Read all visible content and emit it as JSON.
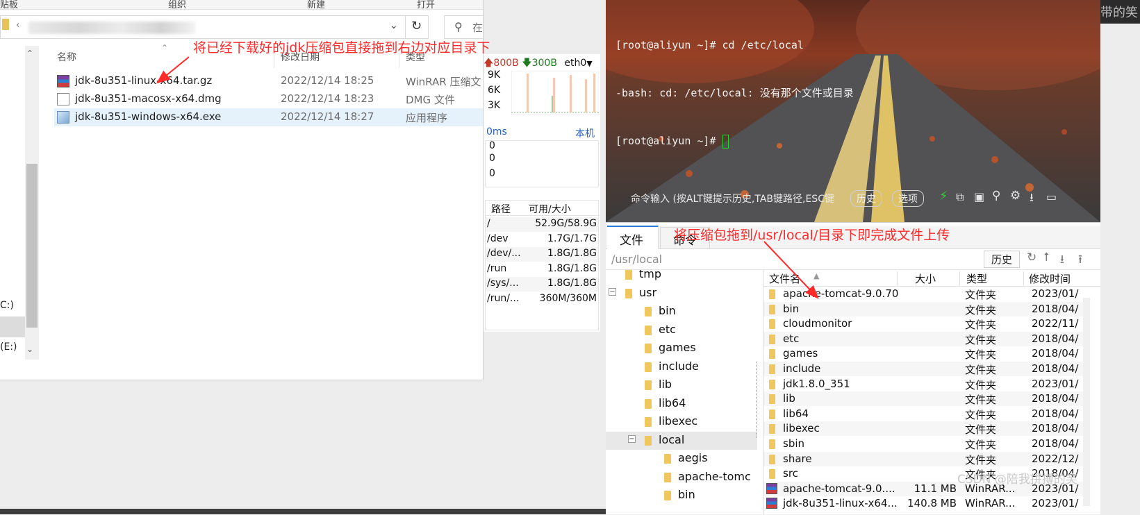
{
  "explorer": {
    "ribbon": {
      "clipboard": "贴板",
      "organize": "组织",
      "new": "新建",
      "open": "打开"
    },
    "address": {
      "chevron": "⌄",
      "refresh": "↻",
      "search_placeholder": "在"
    },
    "nav": {
      "drive_c": "C:)",
      "drive_e": "(E:)"
    },
    "columns": {
      "name": "名称",
      "date": "修改日期",
      "type": "类型"
    },
    "files": [
      {
        "name": "jdk-8u351-linux-x64.tar.gz",
        "date": "2022/12/14 18:25",
        "type": "WinRAR 压缩文",
        "icon": "winrar-archive-icon"
      },
      {
        "name": "jdk-8u351-macosx-x64.dmg",
        "date": "2022/12/14 18:23",
        "type": "DMG 文件",
        "icon": "document-icon"
      },
      {
        "name": "jdk-8u351-windows-x64.exe",
        "date": "2022/12/14 18:27",
        "type": "应用程序",
        "icon": "installer-icon"
      }
    ]
  },
  "annotations": {
    "top": "将已经下载好的jdk压缩包直接拖到右边对应目录下",
    "bottom": "将压缩包拖到/usr/local/目录下即完成文件上传"
  },
  "monitor": {
    "up_rate": "800B",
    "down_rate": "300B",
    "interface": "eth0",
    "y_ticks": [
      "9K",
      "6K",
      "3K"
    ],
    "latency": "0ms",
    "host": "本机",
    "latency_values": [
      "0",
      "0",
      "0"
    ],
    "disk_headers": {
      "path": "路径",
      "usage": "可用/大小"
    },
    "disks": [
      {
        "path": "/",
        "usage": "52.9G/58.9G"
      },
      {
        "path": "/dev",
        "usage": "1.7G/1.7G"
      },
      {
        "path": "/dev/...",
        "usage": "1.8G/1.8G"
      },
      {
        "path": "/run",
        "usage": "1.8G/1.8G"
      },
      {
        "path": "/sys/...",
        "usage": "1.8G/1.8G"
      },
      {
        "path": "/run/...",
        "usage": "360M/360M"
      }
    ]
  },
  "terminal": {
    "lines": [
      "[root@aliyun ~]# cd /etc/local",
      "-bash: cd: /etc/local: 没有那个文件或目录",
      "[root@aliyun ~]# "
    ],
    "input_placeholder": "命令输入 (按ALT键提示历史,TAB键路径,ESC键",
    "history_btn": "历史",
    "options_btn": "选项",
    "corner_text": "带的笑"
  },
  "filepanel": {
    "tabs": [
      "文件",
      "命令"
    ],
    "path": "/usr/local",
    "history_btn": "历史",
    "tree": [
      {
        "label": "tmp",
        "level": 1,
        "toggle": ""
      },
      {
        "label": "usr",
        "level": 1,
        "toggle": "−"
      },
      {
        "label": "bin",
        "level": 2,
        "toggle": ""
      },
      {
        "label": "etc",
        "level": 2,
        "toggle": ""
      },
      {
        "label": "games",
        "level": 2,
        "toggle": ""
      },
      {
        "label": "include",
        "level": 2,
        "toggle": ""
      },
      {
        "label": "lib",
        "level": 2,
        "toggle": ""
      },
      {
        "label": "lib64",
        "level": 2,
        "toggle": ""
      },
      {
        "label": "libexec",
        "level": 2,
        "toggle": ""
      },
      {
        "label": "local",
        "level": 2,
        "toggle": "−",
        "selected": true
      },
      {
        "label": "aegis",
        "level": 3,
        "toggle": ""
      },
      {
        "label": "apache-tomc",
        "level": 3,
        "toggle": ""
      },
      {
        "label": "bin",
        "level": 3,
        "toggle": ""
      }
    ],
    "columns": {
      "name": "文件名",
      "size": "大小",
      "type": "类型",
      "modified": "修改时间"
    },
    "rows": [
      {
        "name": "apache-tomcat-9.0.70",
        "size": "",
        "type": "文件夹",
        "modified": "2023/01/",
        "kind": "folder"
      },
      {
        "name": "bin",
        "size": "",
        "type": "文件夹",
        "modified": "2018/04/",
        "kind": "folder"
      },
      {
        "name": "cloudmonitor",
        "size": "",
        "type": "文件夹",
        "modified": "2022/11/",
        "kind": "folder"
      },
      {
        "name": "etc",
        "size": "",
        "type": "文件夹",
        "modified": "2018/04/",
        "kind": "folder"
      },
      {
        "name": "games",
        "size": "",
        "type": "文件夹",
        "modified": "2018/04/",
        "kind": "folder"
      },
      {
        "name": "include",
        "size": "",
        "type": "文件夹",
        "modified": "2018/04/",
        "kind": "folder"
      },
      {
        "name": "jdk1.8.0_351",
        "size": "",
        "type": "文件夹",
        "modified": "2023/01/",
        "kind": "folder"
      },
      {
        "name": "lib",
        "size": "",
        "type": "文件夹",
        "modified": "2018/04/",
        "kind": "folder"
      },
      {
        "name": "lib64",
        "size": "",
        "type": "文件夹",
        "modified": "2018/04/",
        "kind": "folder"
      },
      {
        "name": "libexec",
        "size": "",
        "type": "文件夹",
        "modified": "2018/04/",
        "kind": "folder"
      },
      {
        "name": "sbin",
        "size": "",
        "type": "文件夹",
        "modified": "2018/04/",
        "kind": "folder"
      },
      {
        "name": "share",
        "size": "",
        "type": "文件夹",
        "modified": "2022/12/",
        "kind": "folder"
      },
      {
        "name": "src",
        "size": "",
        "type": "文件夹",
        "modified": "2018/04/",
        "kind": "folder"
      },
      {
        "name": "apache-tomcat-9.0....",
        "size": "11.1 MB",
        "type": "WinRAR...",
        "modified": "2023/01/",
        "kind": "archive"
      },
      {
        "name": "jdk-8u351-linux-x64...",
        "size": "140.8 MB",
        "type": "WinRAR...",
        "modified": "2023/01/",
        "kind": "archive"
      }
    ],
    "watermark": "CSDN @陪我拼搏的笑"
  },
  "colors": {
    "annotation_red": "#ff2a2a",
    "up_arrow": "#c0392b",
    "down_arrow": "#1e7a1e",
    "link_blue": "#1f5fbf",
    "selection": "#e5f1fb"
  }
}
